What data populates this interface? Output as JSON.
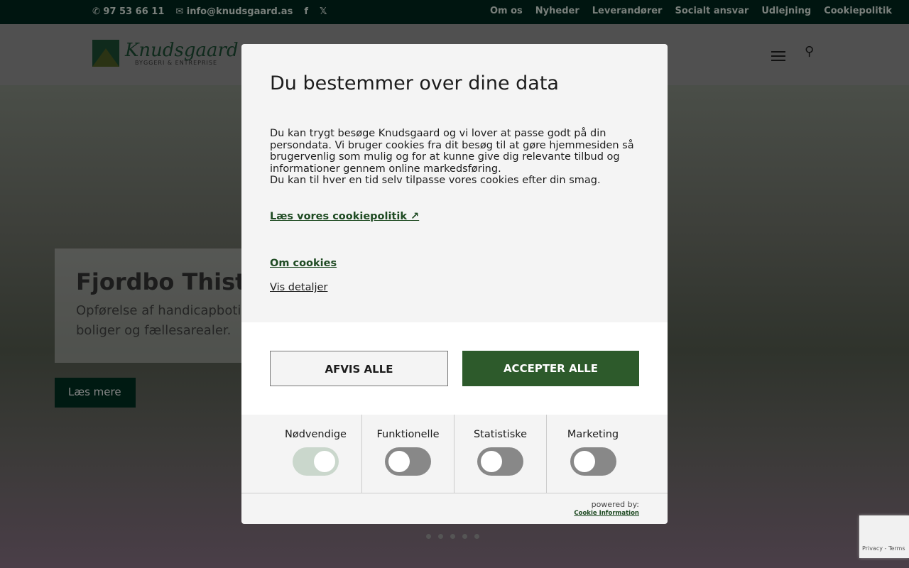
{
  "topbar": {
    "phone": "97 53 66 11",
    "email": "info@knudsgaard.as",
    "links": [
      "Om os",
      "Nyheder",
      "Leverandører",
      "Socialt ansvar",
      "Udlejning",
      "Cookiepolitik"
    ]
  },
  "logo": {
    "name": "Knudsgaard",
    "tagline": "BYGGERI & ENTREPRISE"
  },
  "hero": {
    "title": "Fjordbo Thisted",
    "text_line1": "Opførelse af handicapbotilbud",
    "text_line2": "boliger og fællesarealer.",
    "button": "Læs mere"
  },
  "modal": {
    "title": "Du bestemmer over dine data",
    "body1": "Du kan trygt besøge Knudsgaard og vi lover at passe godt på din persondata. Vi bruger cookies fra dit besøg til at gøre hjemmesiden så brugervenlig som mulig og for at kunne give dig relevante tilbud og informationer gennem online markedsføring.",
    "body2": "Du kan til hver en tid selv tilpasse vores cookies efter din smag.",
    "policy_link": "Læs vores cookiepolitik",
    "about_link": "Om cookies",
    "details_link": "Vis detaljer",
    "reject": "AFVIS ALLE",
    "accept": "ACCEPTER ALLE",
    "accent": "#2d5a2b",
    "categories": [
      {
        "label": "Nødvendige",
        "on": true
      },
      {
        "label": "Funktionelle",
        "on": false
      },
      {
        "label": "Statistiske",
        "on": false
      },
      {
        "label": "Marketing",
        "on": false
      }
    ],
    "powered": "powered by:",
    "provider": "Cookie Information"
  },
  "recaptcha": "Privacy - Terms"
}
